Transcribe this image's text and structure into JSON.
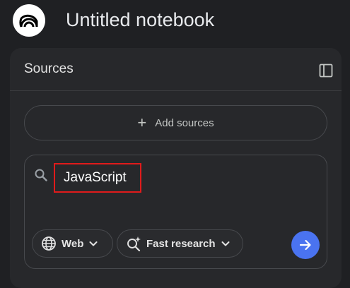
{
  "app": {
    "logo_icon": "notebooklm-logo-icon",
    "notebook_title": "Untitled notebook"
  },
  "sources_panel": {
    "title": "Sources",
    "collapse_icon": "panel-toggle-icon",
    "add_sources_label": "Add sources",
    "add_icon": "plus-icon"
  },
  "research": {
    "search_icon": "search-icon",
    "query_value": "JavaScript",
    "source_chip": {
      "label": "Web",
      "icon": "globe-icon"
    },
    "mode_chip": {
      "label": "Fast research",
      "icon": "sparkle-search-icon"
    },
    "submit_icon": "arrow-right-icon"
  },
  "colors": {
    "background": "#1f2023",
    "panel": "#27282b",
    "accent": "#4a73f0",
    "highlight": "#e01b1b"
  }
}
